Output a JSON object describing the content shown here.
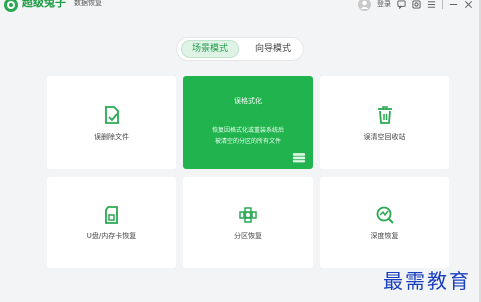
{
  "app": {
    "brand_name": "超级兔子",
    "brand_sub": "数据恢复",
    "login_label": "登录"
  },
  "modes": {
    "scene_label": "场景模式",
    "guide_label": "向导模式"
  },
  "cards": {
    "deleted_files": {
      "label": "误删除文件"
    },
    "formatted": {
      "title": "误格式化",
      "desc_line1": "恢复因格式化或重装系统后",
      "desc_line2": "被清空的分区的所有文件"
    },
    "recycle_bin": {
      "label": "误清空回收站"
    },
    "usb_card": {
      "label": "U盘/内存卡恢复"
    },
    "partition": {
      "label": "分区恢复"
    },
    "deep": {
      "label": "深度恢复"
    }
  },
  "watermark": {
    "text": "最需教育"
  },
  "colors": {
    "brand_green": "#21b34e",
    "icon_green": "#2aa952",
    "watermark_blue": "#1a3fbf"
  }
}
